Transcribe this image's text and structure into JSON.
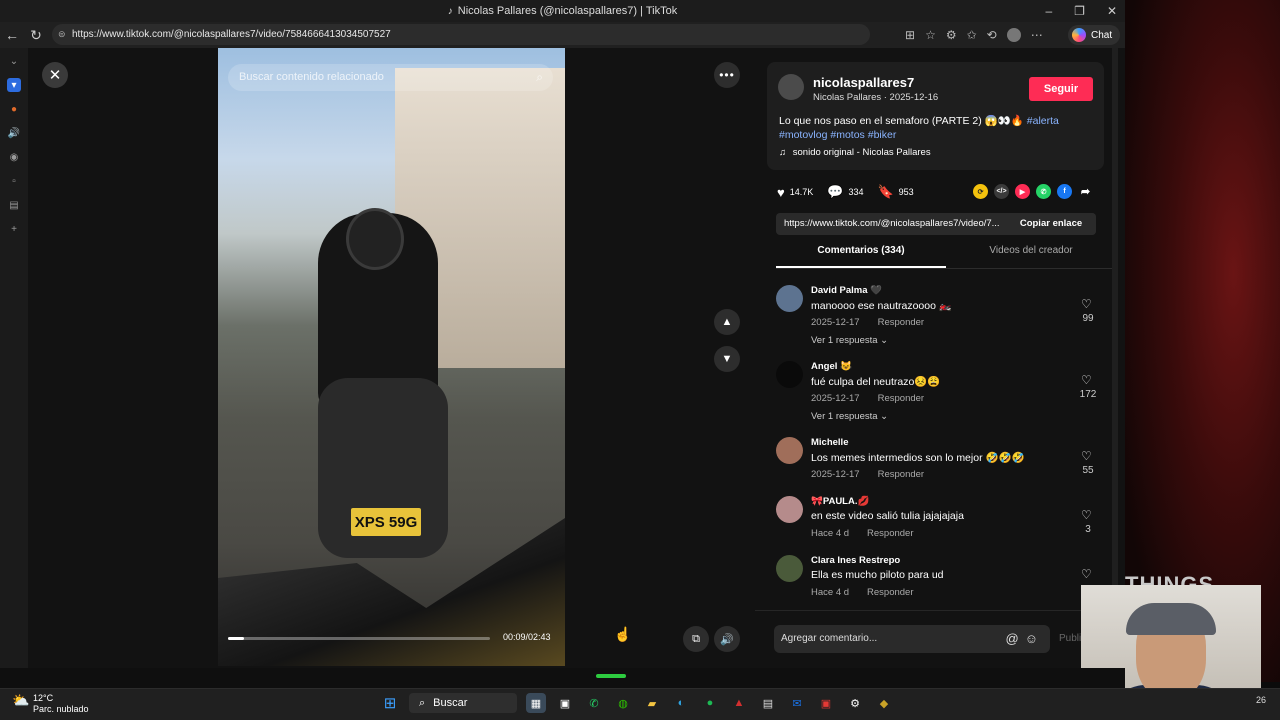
{
  "browser": {
    "title": "Nicolas Pallares (@nicolaspallares7) | TikTok",
    "url": "https://www.tiktok.com/@nicolaspallares7/video/7584666413034507527",
    "chat_label": "Chat"
  },
  "video": {
    "search_placeholder": "Buscar contenido relacionado",
    "plate": "XPS 59G",
    "timecode": "00:09/02:43",
    "progress_fraction": 0.06
  },
  "author": {
    "username": "nicolaspallares7",
    "subline": "Nicolas Pallares · 2025-12-16",
    "follow_label": "Seguir",
    "caption_text": "Lo que nos paso en el semaforo (PARTE 2) 😱👀🔥",
    "caption_tags": [
      "#alerta",
      "#motovlog",
      "#motos",
      "#biker"
    ],
    "sound": "sonido original - Nicolas Pallares"
  },
  "stats": {
    "likes": "14.7K",
    "comments": "334",
    "saves": "953"
  },
  "link": {
    "text": "https://www.tiktok.com/@nicolaspallares7/video/7...",
    "copy_label": "Copiar enlace"
  },
  "tabs": {
    "comments": "Comentarios (334)",
    "creator_videos": "Videos del creador"
  },
  "comments": [
    {
      "name": "David Palma 🖤",
      "text": "manoooo ese nautrazoooo 🏍️",
      "date": "2025-12-17",
      "reply": "Responder",
      "likes": "99",
      "replies": "Ver 1 respuesta ⌄"
    },
    {
      "name": "Angel 😺",
      "text": "fué culpa del neutrazo😣😩",
      "date": "2025-12-17",
      "reply": "Responder",
      "likes": "172",
      "replies": "Ver 1 respuesta ⌄"
    },
    {
      "name": "Michelle",
      "text": "Los memes intermedios son lo mejor 🤣🤣🤣",
      "date": "2025-12-17",
      "reply": "Responder",
      "likes": "55"
    },
    {
      "name": "🎀PAULA.💋",
      "text": "en este video salió tulia jajajajaja",
      "date": "Hace 4 d",
      "reply": "Responder",
      "likes": "3"
    },
    {
      "name": "Clara Ines Restrepo",
      "text": "Ella es mucho piloto para ud",
      "date": "Hace 4 d",
      "reply": "Responder",
      "likes": ""
    }
  ],
  "add_comment": {
    "placeholder": "Agregar comentario...",
    "post_label": "Publi"
  },
  "wallpaper_text": "THINGS",
  "taskbar": {
    "temp": "12°C",
    "weather": "Parc. nublado",
    "search_label": "Buscar",
    "clock": "26"
  },
  "colors": {
    "follow": "#fe2c55",
    "hashtag": "#8ab4ff",
    "background": "#121212"
  }
}
